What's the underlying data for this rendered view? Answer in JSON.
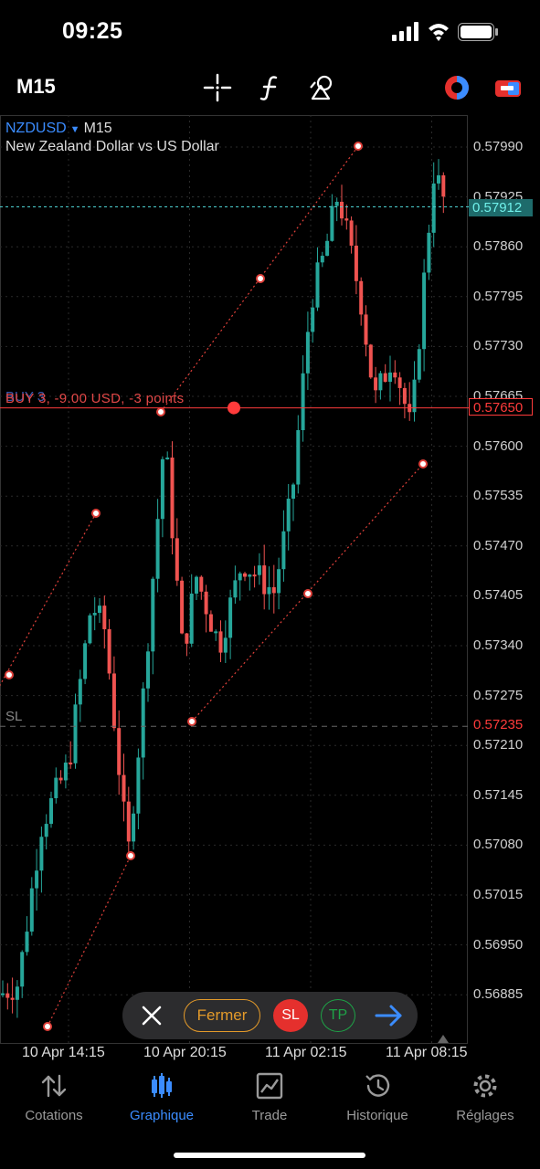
{
  "status_bar": {
    "time": "09:25"
  },
  "toolbar": {
    "timeframe": "M15",
    "icons": [
      "crosshair-icon",
      "function-icon",
      "objects-icon",
      "trading-signals-icon",
      "one-click-icon"
    ]
  },
  "chart": {
    "symbol": "NZDUSD",
    "timeframe": "M15",
    "description": "New Zealand Dollar vs US Dollar",
    "y_axis_labels": [
      "0.57990",
      "0.57925",
      "0.57860",
      "0.57795",
      "0.57730",
      "0.57665",
      "0.57600",
      "0.57535",
      "0.57470",
      "0.57405",
      "0.57340",
      "0.57275",
      "0.57210",
      "0.57145",
      "0.57080",
      "0.57015",
      "0.56950",
      "0.56885"
    ],
    "x_axis_labels": [
      "10 Apr 14:15",
      "10 Apr 20:15",
      "11 Apr 02:15",
      "11 Apr 08:15"
    ],
    "bid_price": "0.57912",
    "position": {
      "label": "BUY 3",
      "info": "BUY 3, -9.00 USD, -3 points",
      "price": "0.57650"
    },
    "stop_loss": {
      "label": "SL",
      "price": "0.57235"
    },
    "colors": {
      "bull": "#26a69a",
      "bear": "#ef5350",
      "position_line": "#ff3b3b",
      "bid_line": "#4dd0d0"
    }
  },
  "trade_bar": {
    "close_label": "Fermer",
    "sl_label": "SL",
    "tp_label": "TP"
  },
  "nav": [
    {
      "label": "Cotations",
      "icon": "quotes-icon",
      "active": false
    },
    {
      "label": "Graphique",
      "icon": "chart-icon",
      "active": true
    },
    {
      "label": "Trade",
      "icon": "trade-icon",
      "active": false
    },
    {
      "label": "Historique",
      "icon": "history-icon",
      "active": false
    },
    {
      "label": "Réglages",
      "icon": "settings-icon",
      "active": false
    }
  ]
}
